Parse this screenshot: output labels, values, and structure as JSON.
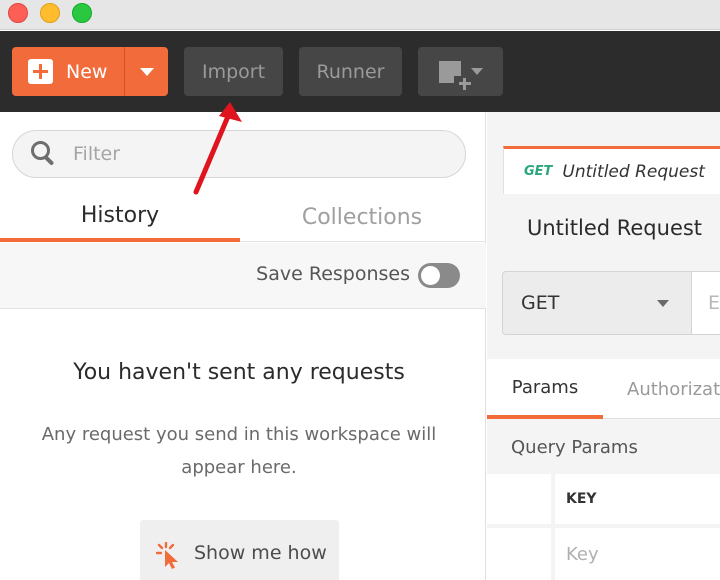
{
  "toolbar": {
    "new_label": "New",
    "import_label": "Import",
    "runner_label": "Runner"
  },
  "sidebar": {
    "filter_placeholder": "Filter",
    "tabs": [
      {
        "label": "History",
        "active": true
      },
      {
        "label": "Collections",
        "active": false
      }
    ],
    "save_responses_label": "Save Responses",
    "save_responses_enabled": false,
    "empty_title": "You haven't sent any requests",
    "empty_description": "Any request you send in this workspace will appear here.",
    "show_me_how_label": "Show me how"
  },
  "request": {
    "tab_method": "GET",
    "tab_name": "Untitled Request",
    "title": "Untitled Request",
    "method": "GET",
    "url_placeholder": "E",
    "sub_tabs": [
      {
        "label": "Params",
        "active": true
      },
      {
        "label": "Authorizat",
        "active": false
      }
    ],
    "query_params_label": "Query Params",
    "key_header": "KEY",
    "key_placeholder": "Key"
  },
  "colors": {
    "accent": "#f26b3a",
    "toolbar_bg": "#2c2c2c",
    "get_method": "#2aa77a",
    "annotation_arrow": "#e0141e"
  },
  "icons": [
    "plus-icon",
    "caret-down-icon",
    "new-window-icon",
    "search-icon",
    "cursor-click-icon"
  ]
}
